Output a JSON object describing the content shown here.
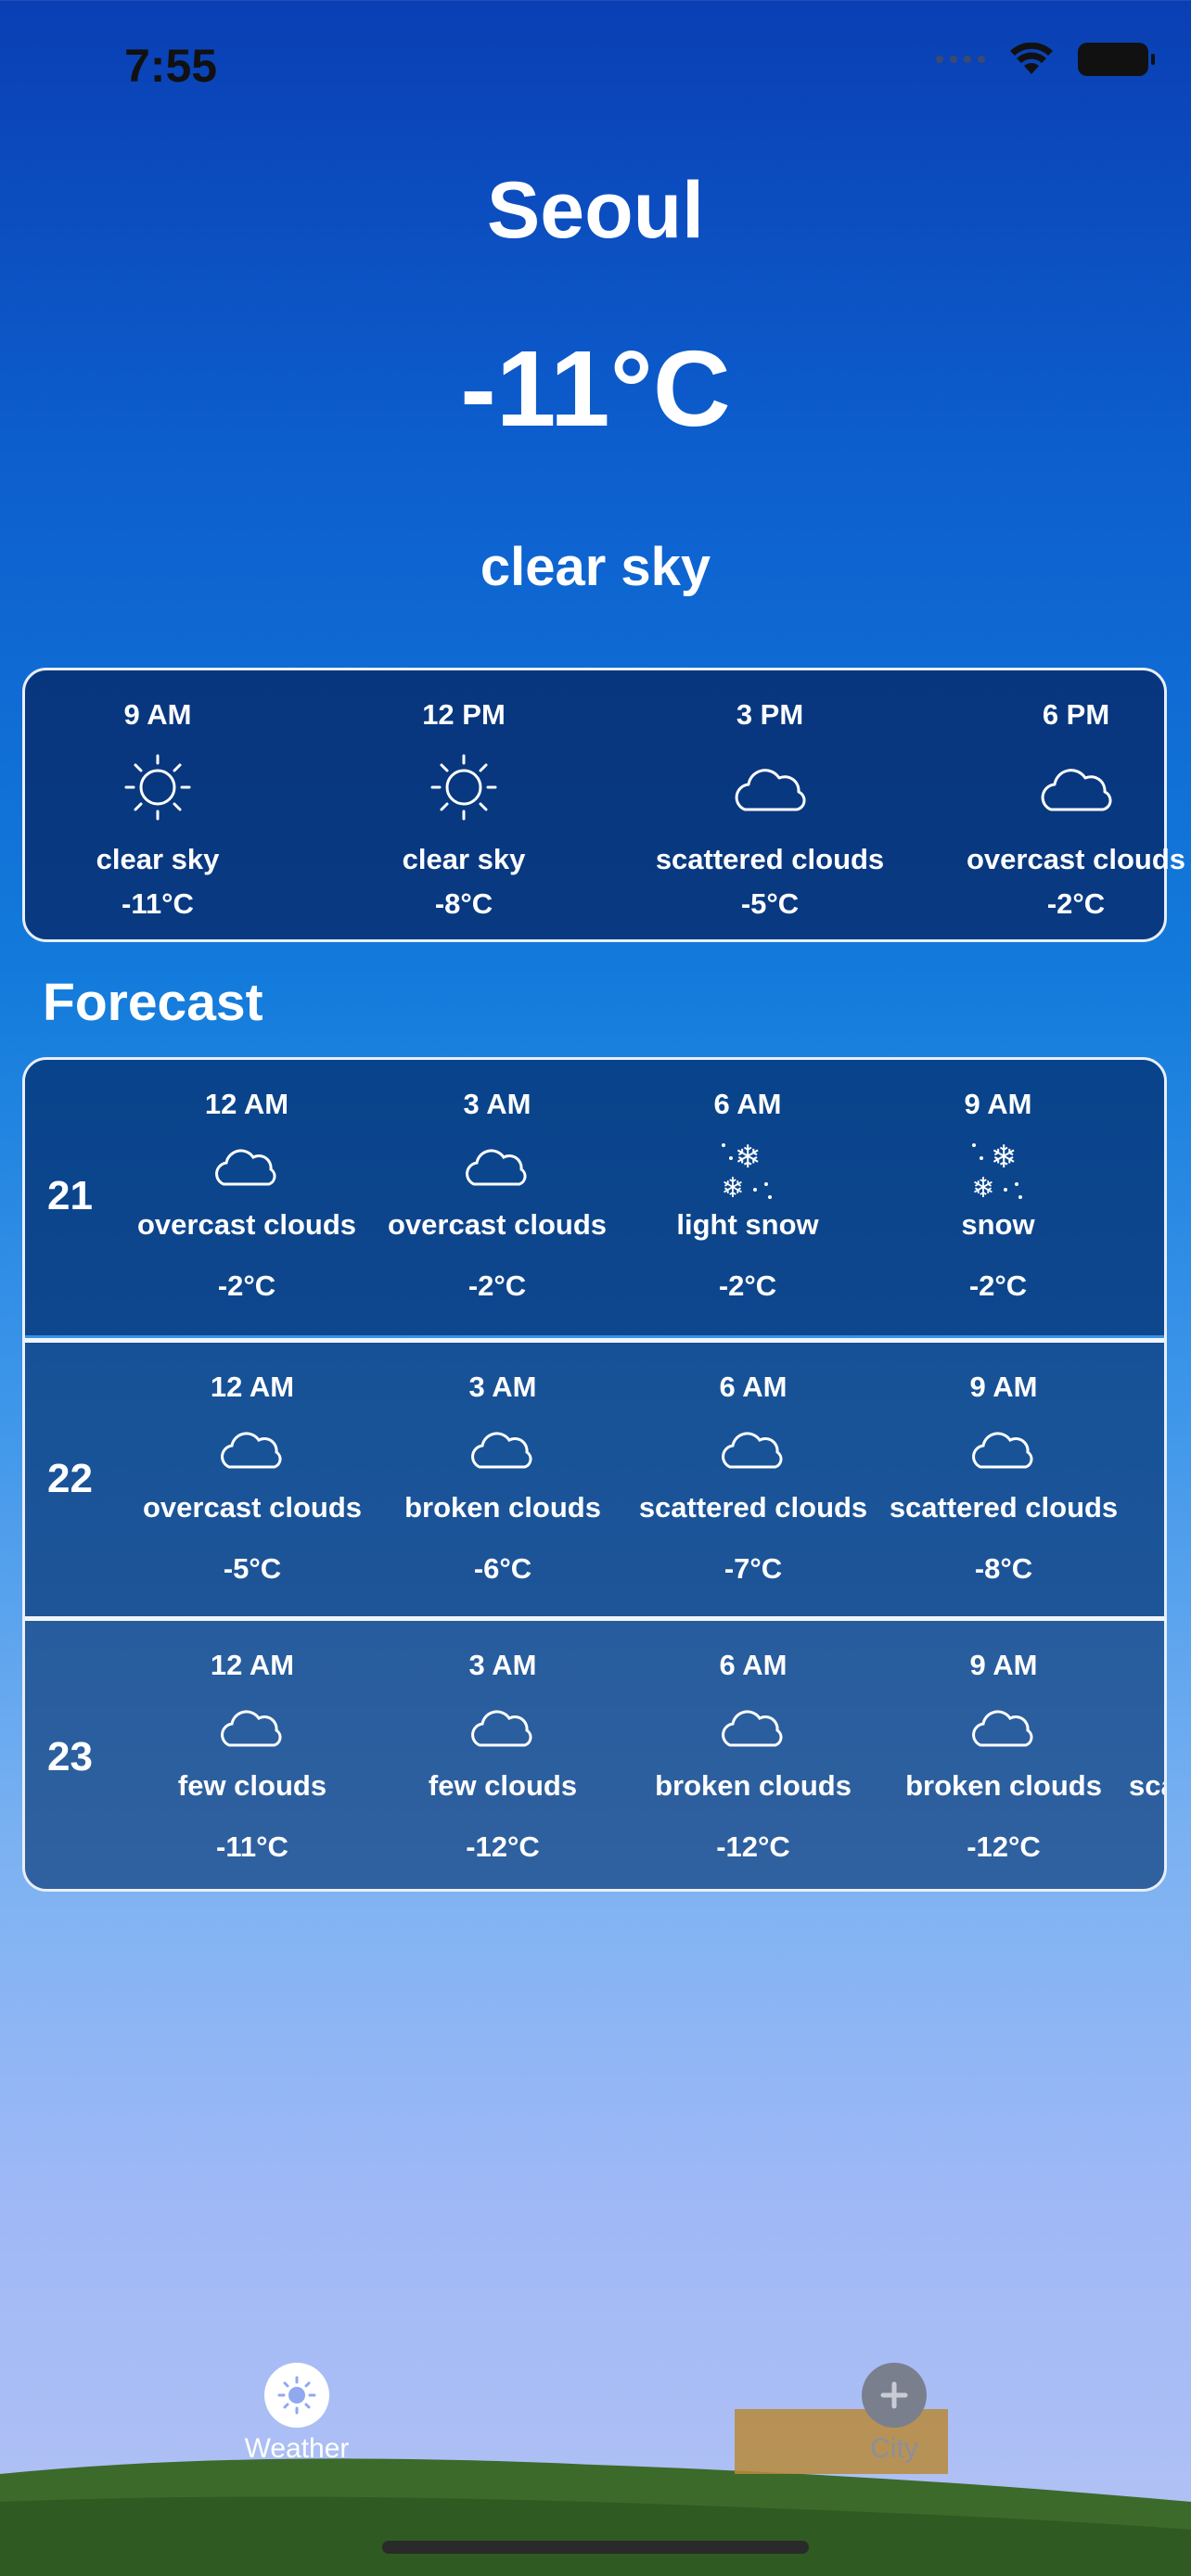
{
  "status": {
    "time": "7:55"
  },
  "current": {
    "city": "Seoul",
    "temp": "-11°C",
    "condition": "clear sky"
  },
  "hourly": [
    {
      "time": "9 AM",
      "icon": "sun-icon",
      "desc": "clear sky",
      "temp": "-11°C"
    },
    {
      "time": "12 PM",
      "icon": "sun-icon",
      "desc": "clear sky",
      "temp": "-8°C"
    },
    {
      "time": "3 PM",
      "icon": "cloud-icon",
      "desc": "scattered clouds",
      "temp": "-5°C"
    },
    {
      "time": "6 PM",
      "icon": "cloud-icon",
      "desc": "overcast clouds",
      "temp": "-2°C"
    }
  ],
  "forecast": {
    "title": "Forecast",
    "days": [
      {
        "day": "21",
        "items": [
          {
            "time": "12 AM",
            "icon": "cloud-icon",
            "desc": "overcast clouds",
            "temp": "-2°C"
          },
          {
            "time": "3 AM",
            "icon": "cloud-icon",
            "desc": "overcast clouds",
            "temp": "-2°C"
          },
          {
            "time": "6 AM",
            "icon": "snow-icon",
            "desc": "light snow",
            "temp": "-2°C"
          },
          {
            "time": "9 AM",
            "icon": "snow-icon",
            "desc": "snow",
            "temp": "-2°C"
          }
        ]
      },
      {
        "day": "22",
        "items": [
          {
            "time": "12 AM",
            "icon": "cloud-icon",
            "desc": "overcast clouds",
            "temp": "-5°C"
          },
          {
            "time": "3 AM",
            "icon": "cloud-icon",
            "desc": "broken clouds",
            "temp": "-6°C"
          },
          {
            "time": "6 AM",
            "icon": "cloud-icon",
            "desc": "scattered clouds",
            "temp": "-7°C"
          },
          {
            "time": "9 AM",
            "icon": "cloud-icon",
            "desc": "scattered clouds",
            "temp": "-8°C"
          }
        ]
      },
      {
        "day": "23",
        "items": [
          {
            "time": "12 AM",
            "icon": "cloud-icon",
            "desc": "few clouds",
            "temp": "-11°C"
          },
          {
            "time": "3 AM",
            "icon": "cloud-icon",
            "desc": "few clouds",
            "temp": "-12°C"
          },
          {
            "time": "6 AM",
            "icon": "cloud-icon",
            "desc": "broken clouds",
            "temp": "-12°C"
          },
          {
            "time": "9 AM",
            "icon": "cloud-icon",
            "desc": "broken clouds",
            "temp": "-12°C"
          },
          {
            "time": "",
            "icon": "",
            "desc": "scattered clouds",
            "temp": ""
          }
        ]
      }
    ]
  },
  "tabbar": {
    "items": [
      {
        "label": "Weather",
        "icon": "sun-icon",
        "active": true
      },
      {
        "label": "City",
        "icon": "plus-icon",
        "active": false
      }
    ]
  },
  "colors": {
    "accent": "#ffffff",
    "card_border": "#e9eef8"
  }
}
